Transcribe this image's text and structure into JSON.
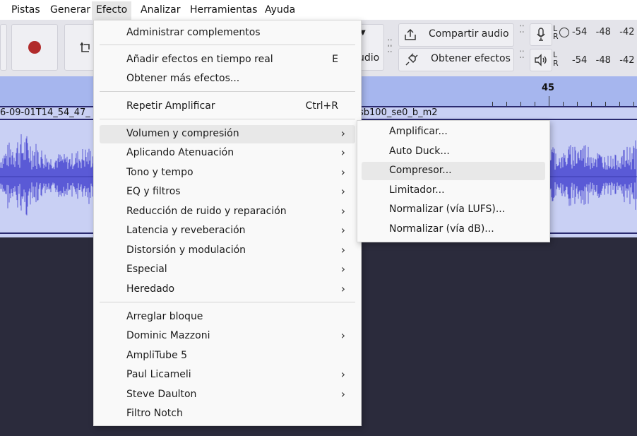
{
  "menubar": {
    "items": [
      "Pistas",
      "Generar",
      "Efecto",
      "Analizar",
      "Herramientas",
      "Ayuda"
    ],
    "active": "Efecto"
  },
  "toolbar": {
    "share_label": "Compartir audio",
    "get_effects_label": "Obtener efectos",
    "partial_label": "udio",
    "meter_scale": [
      "-54",
      "-48",
      "-42"
    ],
    "meter_l": "L",
    "meter_r": "R"
  },
  "ruler": {
    "mark": "45"
  },
  "track": {
    "clip_title_left": "6-09-01T14_54_47_",
    "clip_title_right": "sb100_se0_b_m2",
    "waveform_color": "#5a5ad6"
  },
  "effect_menu": {
    "items": [
      {
        "label": "Administrar complementos",
        "shortcut": "",
        "submenu": false
      },
      {
        "label": "Añadir efectos en tiempo real",
        "shortcut": "E",
        "submenu": false
      },
      {
        "label": "Obtener más efectos...",
        "shortcut": "",
        "submenu": false
      },
      {
        "label": "Repetir Amplificar",
        "shortcut": "Ctrl+R",
        "submenu": false
      },
      {
        "label": "Volumen y compresión",
        "shortcut": "",
        "submenu": true
      },
      {
        "label": "Aplicando Atenuación",
        "shortcut": "",
        "submenu": true
      },
      {
        "label": "Tono y tempo",
        "shortcut": "",
        "submenu": true
      },
      {
        "label": "EQ y filtros",
        "shortcut": "",
        "submenu": true
      },
      {
        "label": "Reducción de ruido y reparación",
        "shortcut": "",
        "submenu": true
      },
      {
        "label": "Latencia y reveberación",
        "shortcut": "",
        "submenu": true
      },
      {
        "label": "Distorsión y modulación",
        "shortcut": "",
        "submenu": true
      },
      {
        "label": "Especial",
        "shortcut": "",
        "submenu": true
      },
      {
        "label": "Heredado",
        "shortcut": "",
        "submenu": true
      },
      {
        "label": "Arreglar bloque",
        "shortcut": "",
        "submenu": false
      },
      {
        "label": "Dominic Mazzoni",
        "shortcut": "",
        "submenu": true
      },
      {
        "label": "AmpliTube 5",
        "shortcut": "",
        "submenu": false
      },
      {
        "label": "Paul Licameli",
        "shortcut": "",
        "submenu": true
      },
      {
        "label": "Steve Daulton",
        "shortcut": "",
        "submenu": true
      },
      {
        "label": "Filtro Notch",
        "shortcut": "",
        "submenu": false
      }
    ],
    "highlighted": "Volumen y compresión"
  },
  "submenu": {
    "items": [
      "Amplificar...",
      "Auto Duck...",
      "Compresor...",
      "Limitador...",
      "Normalizar (vía LUFS)...",
      "Normalizar (vía dB)..."
    ],
    "highlighted": "Compresor..."
  },
  "icons": {
    "record": "record-icon",
    "loop": "loop-icon",
    "share": "share-icon",
    "plugin": "plugin-icon",
    "microphone": "microphone-icon",
    "speaker": "speaker-icon",
    "chevron": "chevron-right-icon"
  }
}
